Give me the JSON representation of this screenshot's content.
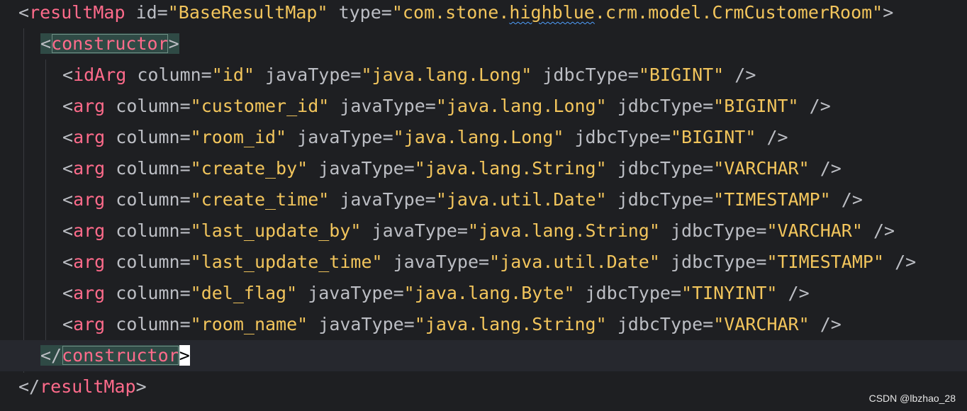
{
  "editor": {
    "line1": {
      "lt": "<",
      "tag": "resultMap",
      "a1": " id=",
      "v1": "\"BaseResultMap\"",
      "a2": " type=",
      "v2a": "\"com.stone.",
      "v2b": "highblue",
      "v2c": ".crm.model.CrmCustomerRoom\"",
      "gt": ">"
    },
    "line2": {
      "lt": "<",
      "tag": "constructor",
      "gt": ">"
    },
    "args": [
      {
        "lt": "<",
        "tag": "idArg",
        "col": " column=",
        "colv": "\"id\"",
        "jt": " javaType=",
        "jtv": "\"java.lang.Long\"",
        "jd": " jdbcType=",
        "jdv": "\"BIGINT\"",
        "end": " />"
      },
      {
        "lt": "<",
        "tag": "arg",
        "col": " column=",
        "colv": "\"customer_id\"",
        "jt": " javaType=",
        "jtv": "\"java.lang.Long\"",
        "jd": " jdbcType=",
        "jdv": "\"BIGINT\"",
        "end": " />"
      },
      {
        "lt": "<",
        "tag": "arg",
        "col": " column=",
        "colv": "\"room_id\"",
        "jt": " javaType=",
        "jtv": "\"java.lang.Long\"",
        "jd": " jdbcType=",
        "jdv": "\"BIGINT\"",
        "end": " />"
      },
      {
        "lt": "<",
        "tag": "arg",
        "col": " column=",
        "colv": "\"create_by\"",
        "jt": " javaType=",
        "jtv": "\"java.lang.String\"",
        "jd": " jdbcType=",
        "jdv": "\"VARCHAR\"",
        "end": " />"
      },
      {
        "lt": "<",
        "tag": "arg",
        "col": " column=",
        "colv": "\"create_time\"",
        "jt": " javaType=",
        "jtv": "\"java.util.Date\"",
        "jd": " jdbcType=",
        "jdv": "\"TIMESTAMP\"",
        "end": " />"
      },
      {
        "lt": "<",
        "tag": "arg",
        "col": " column=",
        "colv": "\"last_update_by\"",
        "jt": " javaType=",
        "jtv": "\"java.lang.String\"",
        "jd": " jdbcType=",
        "jdv": "\"VARCHAR\"",
        "end": " />"
      },
      {
        "lt": "<",
        "tag": "arg",
        "col": " column=",
        "colv": "\"last_update_time\"",
        "jt": " javaType=",
        "jtv": "\"java.util.Date\"",
        "jd": " jdbcType=",
        "jdv": "\"TIMESTAMP\"",
        "end": " />"
      },
      {
        "lt": "<",
        "tag": "arg",
        "col": " column=",
        "colv": "\"del_flag\"",
        "jt": " javaType=",
        "jtv": "\"java.lang.Byte\"",
        "jd": " jdbcType=",
        "jdv": "\"TINYINT\"",
        "end": " />"
      },
      {
        "lt": "<",
        "tag": "arg",
        "col": " column=",
        "colv": "\"room_name\"",
        "jt": " javaType=",
        "jtv": "\"java.lang.String\"",
        "jd": " jdbcType=",
        "jdv": "\"VARCHAR\"",
        "end": " />"
      }
    ],
    "line12": {
      "lt": "</",
      "tag": "constructor",
      "gt": ">"
    },
    "line13": {
      "lt": "</",
      "tag": "resultMap",
      "gt": ">"
    }
  },
  "watermark": "CSDN @lbzhao_28",
  "colors": {
    "background": "#1e1f22",
    "tag": "#ff6b8b",
    "value": "#f2c55c",
    "text": "#bcbec4",
    "current_line": "#26282e",
    "match_highlight": "#2f4a45"
  }
}
